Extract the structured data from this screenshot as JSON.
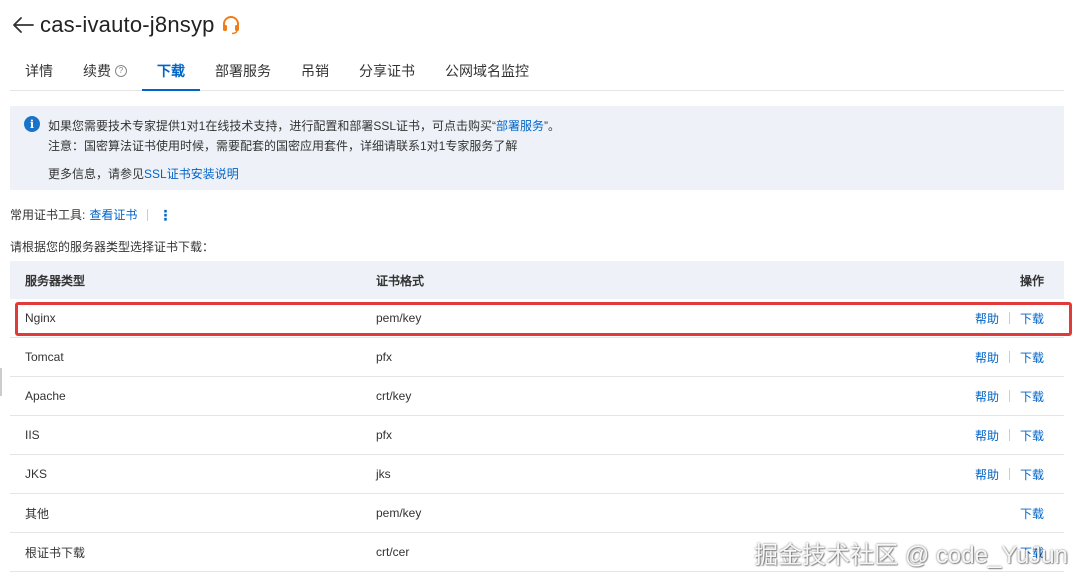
{
  "header": {
    "title": "cas-ivauto-j8nsyp"
  },
  "tabs": [
    {
      "label": "详情",
      "active": false
    },
    {
      "label": "续费",
      "active": false,
      "help": true
    },
    {
      "label": "下载",
      "active": true
    },
    {
      "label": "部署服务",
      "active": false
    },
    {
      "label": "吊销",
      "active": false
    },
    {
      "label": "分享证书",
      "active": false
    },
    {
      "label": "公网域名监控",
      "active": false
    }
  ],
  "notice": {
    "line1_prefix": "如果您需要技术专家提供1对1在线技术支持，进行配置和部署SSL证书，可点击购买“",
    "line1_link": "部署服务",
    "line1_suffix": "”。",
    "line2": "注意：国密算法证书使用时候，需要配套的国密应用套件，详细请联系1对1专家服务了解",
    "line3_prefix": "更多信息，请参见",
    "line3_link": "SSL证书安装说明"
  },
  "tools": {
    "label": "常用证书工具:",
    "view_cert": "查看证书",
    "more": "⋮"
  },
  "prompt": "请根据您的服务器类型选择证书下载：",
  "table": {
    "headers": {
      "type": "服务器类型",
      "format": "证书格式",
      "action": "操作"
    },
    "rows": [
      {
        "type": "Nginx",
        "format": "pem/key",
        "help": "帮助",
        "download": "下载"
      },
      {
        "type": "Tomcat",
        "format": "pfx",
        "help": "帮助",
        "download": "下载"
      },
      {
        "type": "Apache",
        "format": "crt/key",
        "help": "帮助",
        "download": "下载"
      },
      {
        "type": "IIS",
        "format": "pfx",
        "help": "帮助",
        "download": "下载"
      },
      {
        "type": "JKS",
        "format": "jks",
        "help": "帮助",
        "download": "下载"
      },
      {
        "type": "其他",
        "format": "pem/key",
        "help": "",
        "download": "下载"
      },
      {
        "type": "根证书下载",
        "format": "crt/cer",
        "help": "",
        "download": "下载"
      }
    ]
  },
  "watermark": "掘金技术社区 @ code_YuJun",
  "colors": {
    "accent": "#0064c8",
    "notice_bg": "#eef2f8",
    "highlight": "#e03a3a",
    "support_icon": "#f07c1a"
  }
}
